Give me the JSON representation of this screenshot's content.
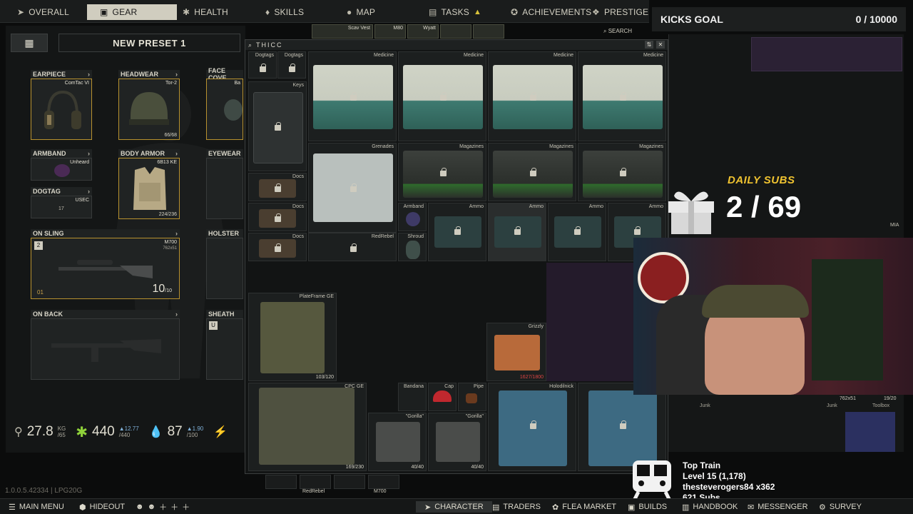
{
  "nav": {
    "tabs": [
      {
        "label": "OVERALL",
        "icon": "arrow-icon"
      },
      {
        "label": "GEAR",
        "icon": "gear-vest-icon",
        "active": true
      },
      {
        "label": "HEALTH",
        "icon": "health-icon"
      },
      {
        "label": "SKILLS",
        "icon": "skills-icon"
      },
      {
        "label": "MAP",
        "icon": "map-pin-icon"
      },
      {
        "label": "TASKS",
        "icon": "tasks-icon",
        "warning": "▲"
      },
      {
        "label": "ACHIEVEMENTS",
        "icon": "achievement-icon"
      },
      {
        "label": "PRESTIGE",
        "icon": "prestige-icon"
      }
    ]
  },
  "preset": {
    "name": "NEW PRESET 1"
  },
  "gear": {
    "earpiece": {
      "label": "EARPIECE",
      "item": "ComTac VI"
    },
    "headwear": {
      "label": "HEADWEAR",
      "item": "Tor-2",
      "durability": "66/68"
    },
    "face_cover": {
      "label": "FACE COVE",
      "item": "Ba"
    },
    "armband": {
      "label": "ARMBAND",
      "item": "Unheard"
    },
    "body_armor": {
      "label": "BODY ARMOR",
      "item": "6B13 KE",
      "durability": "224/236"
    },
    "eyewear": {
      "label": "EYEWEAR"
    },
    "dogtag": {
      "label": "DOGTAG",
      "item": "USEC",
      "count": "17"
    },
    "on_sling": {
      "label": "ON SLING",
      "item": "M700",
      "caliber": "762x51",
      "ammo_cur": "10",
      "ammo_max": "/10",
      "slot_num": "2",
      "level": "01"
    },
    "holster": {
      "label": "HOLSTER"
    },
    "on_back": {
      "label": "ON BACK"
    },
    "sheath": {
      "label": "SHEATH",
      "slot_key": "U"
    }
  },
  "stats": {
    "weight": "27.8",
    "weight_unit": "KG",
    "weight_max": "/65",
    "energy": "440",
    "energy_delta": "▲12.77",
    "energy_max": "/440",
    "hydration": "87",
    "hydration_delta": "▲1.90",
    "hydration_max": "/100"
  },
  "stash": {
    "title": "THICC",
    "sort_btn": "⇅",
    "close_btn": "✕",
    "labels": {
      "dogtags": "Dogtags",
      "medicine": "Medicine",
      "keys": "Keys",
      "grenades": "Grenades",
      "magazines": "Magazines",
      "docs": "Docs",
      "armband": "Armband",
      "ammo": "Ammo",
      "redrebel": "RedRebel",
      "shroud": "Shroud",
      "plateframe": "PlateFrame GE",
      "plateframe_count": "103/120",
      "grizzly": "Grizzly",
      "grizzly_count": "1627/1800",
      "cpc": "CPC GE",
      "cpc_count": "169/230",
      "bandana": "Bandana",
      "cap": "Cap",
      "pipe": "Pipe",
      "gorilla": "\"Gorilla\"",
      "gorilla_count": "40/40",
      "holodilnick": "Holodilnick"
    }
  },
  "strip": {
    "scav_vest": "Scav Vest",
    "m80": "M80",
    "wyatt": "Wyatt"
  },
  "search_label": "SEARCH",
  "overlay": {
    "kicks_title": "KICKS GOAL",
    "kicks_value": "0 / 10000",
    "daily_subs_label": "DAILY SUBS",
    "daily_subs_value": "2 / 69",
    "train_title": "Top Train",
    "train_level": "Level 15 (1,178)",
    "train_user": "thesteverogers84 x362",
    "train_subs": "621 Subs",
    "mia": "MIA",
    "ammo_762": "762x51",
    "ammo_count": "19/20",
    "junk": "Junk",
    "toolbox": "Toolbox"
  },
  "version": "1.0.0.5.42334 | LPG20G",
  "bottom_slots": {
    "redrebel": "RedRebel",
    "m700": "M700"
  },
  "bottombar": {
    "main_menu": "MAIN MENU",
    "hideout": "HIDEOUT",
    "character": "CHARACTER",
    "traders": "TRADERS",
    "flea": "FLEA MARKET",
    "builds": "BUILDS",
    "handbook": "HANDBOOK",
    "messenger": "MESSENGER",
    "survey": "SURVEY"
  }
}
